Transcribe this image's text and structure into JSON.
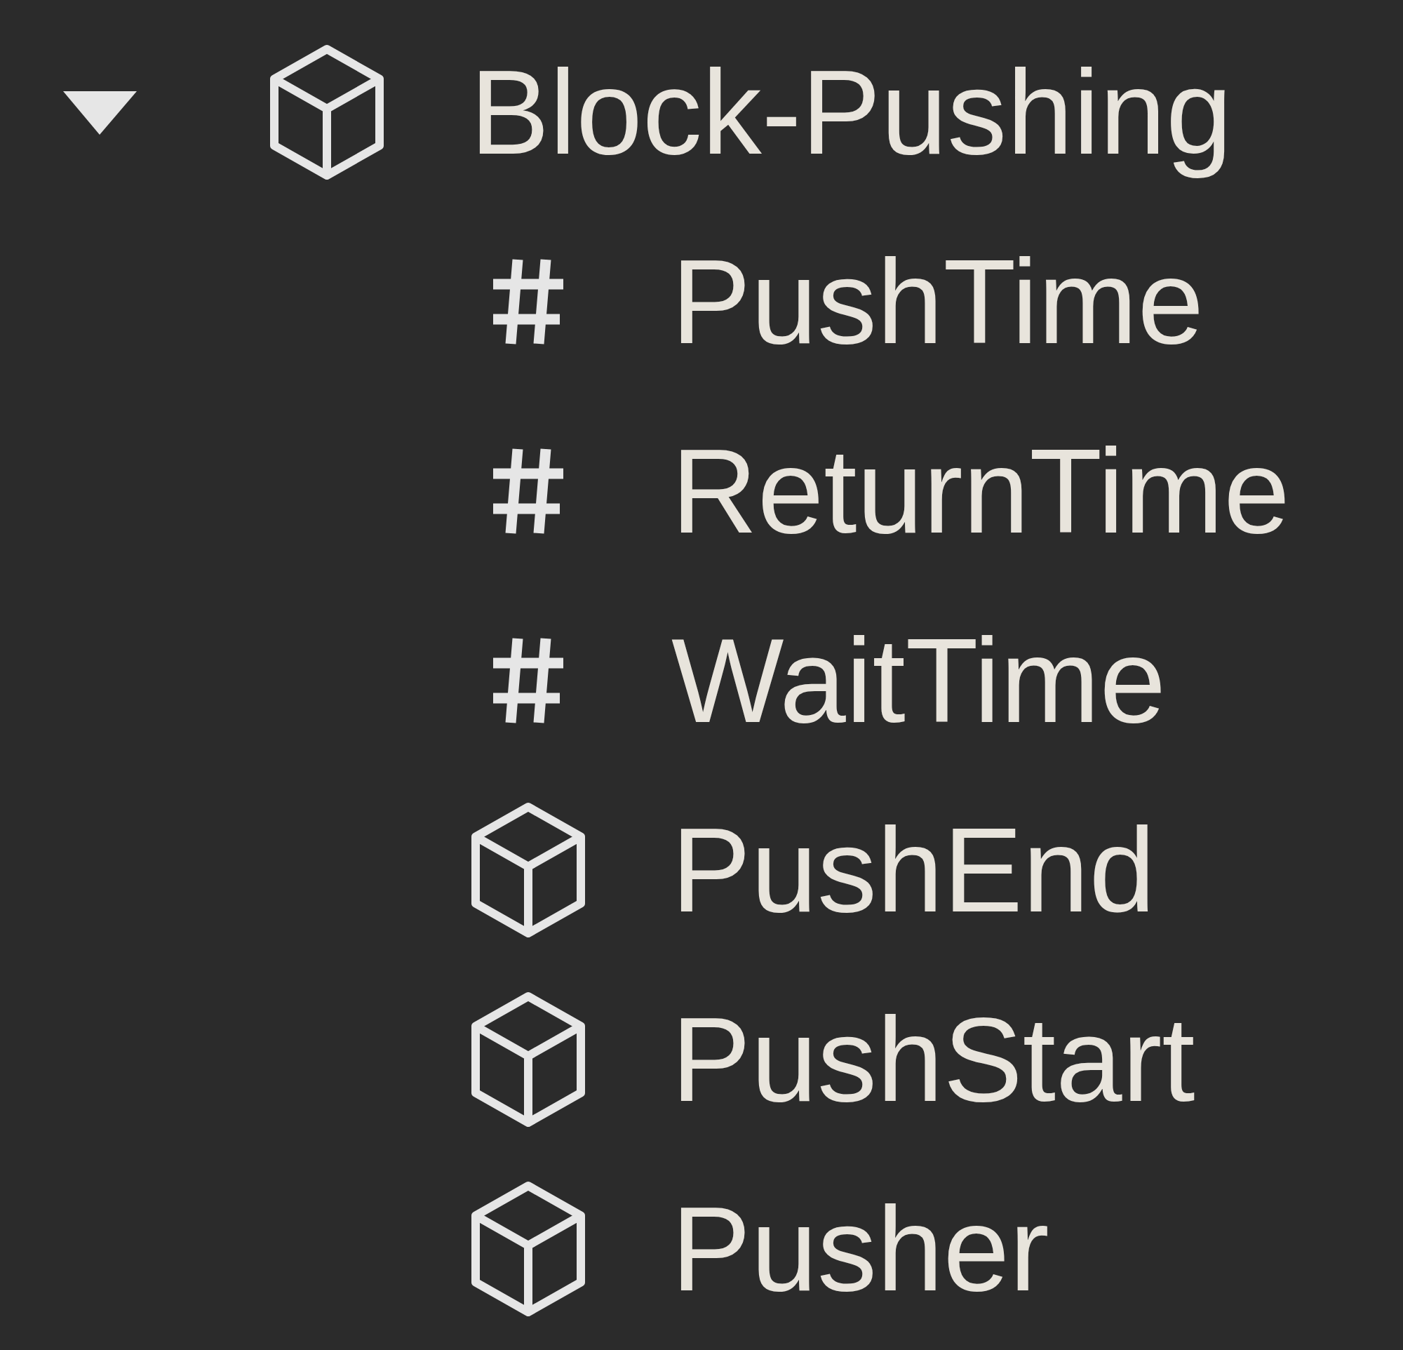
{
  "tree": [
    {
      "label": "Block-Pushing",
      "kind": "part",
      "expanded": true,
      "children": [
        {
          "label": "PushTime",
          "kind": "number"
        },
        {
          "label": "ReturnTime",
          "kind": "number"
        },
        {
          "label": "WaitTime",
          "kind": "number"
        },
        {
          "label": "PushEnd",
          "kind": "part"
        },
        {
          "label": "PushStart",
          "kind": "part"
        },
        {
          "label": "Pusher",
          "kind": "part"
        }
      ]
    }
  ]
}
